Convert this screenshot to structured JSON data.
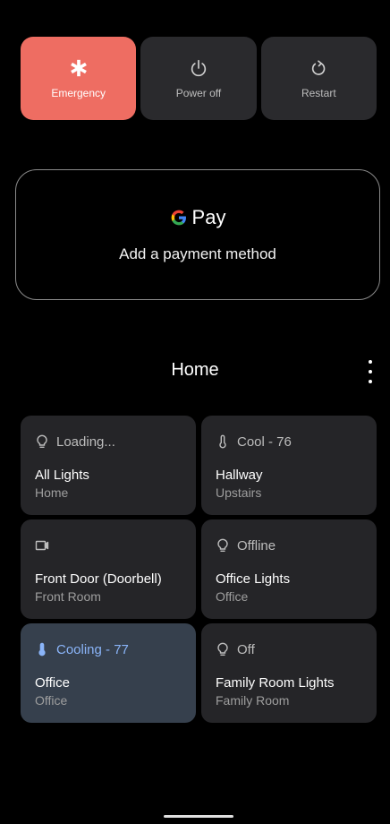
{
  "power_menu": {
    "emergency_label": "Emergency",
    "power_off_label": "Power off",
    "restart_label": "Restart",
    "emergency_color": "#ee6d62"
  },
  "gpay": {
    "logo_text": "Pay",
    "subtitle": "Add a payment method"
  },
  "home": {
    "title": "Home"
  },
  "controls": [
    {
      "icon": "lightbulb-icon",
      "status": "Loading...",
      "title": "All Lights",
      "subtitle": "Home",
      "active": false
    },
    {
      "icon": "thermometer-icon",
      "status": "Cool - 76",
      "title": "Hallway",
      "subtitle": "Upstairs",
      "active": false
    },
    {
      "icon": "camera-icon",
      "status": "",
      "title": "Front Door (Doorbell)",
      "subtitle": "Front Room",
      "active": false
    },
    {
      "icon": "lightbulb-icon",
      "status": "Offline",
      "title": "Office Lights",
      "subtitle": "Office",
      "active": false
    },
    {
      "icon": "thermometer-icon",
      "status": "Cooling - 77",
      "title": "Office",
      "subtitle": "Office",
      "active": true
    },
    {
      "icon": "lightbulb-icon",
      "status": "Off",
      "title": "Family Room Lights",
      "subtitle": "Family Room",
      "active": false
    }
  ]
}
